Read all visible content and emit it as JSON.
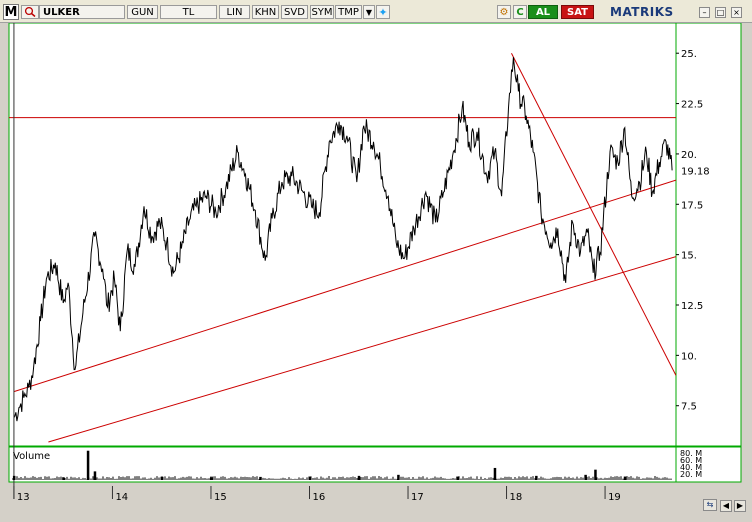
{
  "toolbar": {
    "logo": "M",
    "symbol": "ULKER",
    "buttons": [
      "GUN",
      "TL",
      "LIN",
      "KHN",
      "SVD",
      "SYM",
      "TMP"
    ],
    "buy_label": "AL",
    "sell_label": "SAT",
    "brand": "MATRIKS"
  },
  "volume_label": "Volume",
  "volume_ticks": [
    "80. M",
    "60. M",
    "40. M",
    "20. M"
  ],
  "colors": {
    "price": "#000000",
    "trend": "#cc0000",
    "axis_border": "#00aa00",
    "current_price_box": "#ffffff"
  },
  "chart_data": {
    "type": "line",
    "title": "",
    "xlabel": "",
    "ylabel": "",
    "x_ticks": [
      "13",
      "14",
      "15",
      "16",
      "17",
      "18",
      "19"
    ],
    "x_range": [
      2012.95,
      2019.72
    ],
    "ylim": [
      5.5,
      26.5
    ],
    "y_ticks": [
      7.5,
      10,
      12.5,
      15,
      17.5,
      20,
      22.5,
      25
    ],
    "last_price": "19.18",
    "series": [
      {
        "values": [
          [
            2013.0,
            6.9
          ],
          [
            2013.05,
            7.4
          ],
          [
            2013.1,
            7.9
          ],
          [
            2013.15,
            8.4
          ],
          [
            2013.2,
            9.4
          ],
          [
            2013.27,
            11.7
          ],
          [
            2013.33,
            13.8
          ],
          [
            2013.42,
            14.6
          ],
          [
            2013.5,
            12.6
          ],
          [
            2013.55,
            13.6
          ],
          [
            2013.62,
            9.3
          ],
          [
            2013.7,
            12.1
          ],
          [
            2013.82,
            15.9
          ],
          [
            2013.9,
            14.3
          ],
          [
            2013.95,
            12.4
          ],
          [
            2014.02,
            13.8
          ],
          [
            2014.08,
            11.2
          ],
          [
            2014.15,
            15.2
          ],
          [
            2014.23,
            14.4
          ],
          [
            2014.32,
            17.4
          ],
          [
            2014.4,
            15.9
          ],
          [
            2014.48,
            16.6
          ],
          [
            2014.55,
            15.6
          ],
          [
            2014.62,
            14.1
          ],
          [
            2014.7,
            15.3
          ],
          [
            2014.78,
            16.7
          ],
          [
            2014.85,
            17.4
          ],
          [
            2014.95,
            17.9
          ],
          [
            2015.05,
            17.1
          ],
          [
            2015.15,
            18.3
          ],
          [
            2015.27,
            20.1
          ],
          [
            2015.35,
            19.0
          ],
          [
            2015.45,
            17.2
          ],
          [
            2015.55,
            14.7
          ],
          [
            2015.62,
            16.8
          ],
          [
            2015.72,
            18.6
          ],
          [
            2015.82,
            18.9
          ],
          [
            2015.92,
            18.2
          ],
          [
            2016.02,
            17.4
          ],
          [
            2016.1,
            17.1
          ],
          [
            2016.2,
            20.6
          ],
          [
            2016.3,
            21.6
          ],
          [
            2016.38,
            20.9
          ],
          [
            2016.48,
            18.6
          ],
          [
            2016.55,
            21.4
          ],
          [
            2016.65,
            20.6
          ],
          [
            2016.72,
            19.4
          ],
          [
            2016.8,
            17.9
          ],
          [
            2016.88,
            15.6
          ],
          [
            2016.96,
            14.8
          ],
          [
            2017.06,
            16.3
          ],
          [
            2017.18,
            18.1
          ],
          [
            2017.28,
            16.6
          ],
          [
            2017.36,
            18.1
          ],
          [
            2017.46,
            20.1
          ],
          [
            2017.55,
            22.3
          ],
          [
            2017.62,
            20.6
          ],
          [
            2017.7,
            21.1
          ],
          [
            2017.8,
            18.9
          ],
          [
            2017.88,
            20.1
          ],
          [
            2017.95,
            17.9
          ],
          [
            2018.02,
            22.3
          ],
          [
            2018.07,
            24.8
          ],
          [
            2018.12,
            23.1
          ],
          [
            2018.2,
            21.9
          ],
          [
            2018.27,
            20.1
          ],
          [
            2018.35,
            17.1
          ],
          [
            2018.45,
            15.6
          ],
          [
            2018.52,
            16.3
          ],
          [
            2018.6,
            13.6
          ],
          [
            2018.67,
            16.6
          ],
          [
            2018.75,
            15.1
          ],
          [
            2018.82,
            16.1
          ],
          [
            2018.88,
            14.1
          ],
          [
            2018.95,
            15.1
          ],
          [
            2019.05,
            20.1
          ],
          [
            2019.13,
            19.6
          ],
          [
            2019.2,
            21.3
          ],
          [
            2019.27,
            17.9
          ],
          [
            2019.35,
            18.6
          ],
          [
            2019.42,
            20.1
          ],
          [
            2019.48,
            18.1
          ],
          [
            2019.55,
            19.6
          ],
          [
            2019.62,
            20.6
          ],
          [
            2019.68,
            19.18
          ]
        ]
      }
    ],
    "trendlines": [
      {
        "points": [
          [
            2013.0,
            8.2
          ],
          [
            2019.72,
            18.7
          ]
        ]
      },
      {
        "points": [
          [
            2013.35,
            5.7
          ],
          [
            2019.72,
            14.9
          ]
        ]
      },
      {
        "points": [
          [
            2018.05,
            25.0
          ],
          [
            2019.72,
            9.0
          ]
        ]
      },
      {
        "points": [
          [
            2012.95,
            21.8
          ],
          [
            2019.72,
            21.8
          ]
        ]
      }
    ],
    "cursor_x": 2013.0,
    "volume": {
      "unit": "M",
      "ylim": [
        0,
        90
      ],
      "bars": [
        [
          2013.0,
          12
        ],
        [
          2013.5,
          8
        ],
        [
          2013.75,
          85
        ],
        [
          2013.82,
          25
        ],
        [
          2014.5,
          10
        ],
        [
          2015.0,
          8
        ],
        [
          2015.5,
          9
        ],
        [
          2016.0,
          10
        ],
        [
          2016.5,
          12
        ],
        [
          2016.9,
          15
        ],
        [
          2017.5,
          10
        ],
        [
          2017.88,
          35
        ],
        [
          2018.3,
          12
        ],
        [
          2018.8,
          15
        ],
        [
          2018.9,
          30
        ],
        [
          2019.2,
          10
        ]
      ]
    }
  }
}
